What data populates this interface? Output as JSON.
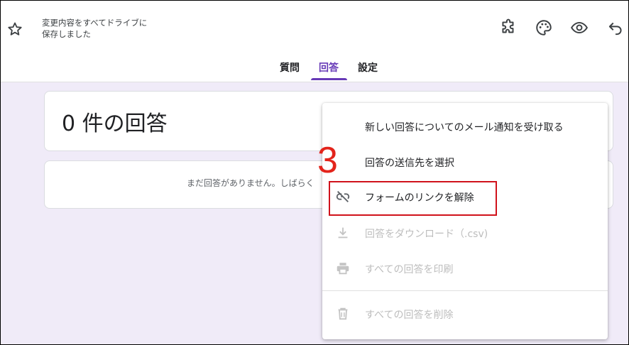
{
  "header": {
    "save_status_line1": "変更内容をすべてドライブに",
    "save_status_line2": "保存しました",
    "tabs": [
      {
        "label": "質問"
      },
      {
        "label": "回答"
      },
      {
        "label": "設定"
      }
    ],
    "active_tab": "回答",
    "icons": [
      "star-outline-icon",
      "puzzle-addon-icon",
      "palette-icon",
      "eye-preview-icon",
      "undo-icon"
    ]
  },
  "responses": {
    "count_label": "0 件の回答",
    "empty_message": "まだ回答がありません。しばらく"
  },
  "menu": {
    "items": [
      {
        "label": "新しい回答についてのメール通知を受け取る",
        "enabled": true
      },
      {
        "label": "回答の送信先を選択",
        "enabled": true
      },
      {
        "label": "フォームのリンクを解除",
        "enabled": true,
        "icon": "unlink-icon"
      },
      {
        "label": "回答をダウンロード（.csv)",
        "enabled": false,
        "icon": "download-icon"
      },
      {
        "label": "すべての回答を印刷",
        "enabled": false,
        "icon": "print-icon"
      },
      {
        "label": "すべての回答を削除",
        "enabled": false,
        "icon": "trash-icon"
      }
    ]
  },
  "annotation": {
    "step_number": "3"
  },
  "colors": {
    "accent": "#673ab7",
    "background": "#f0ebf8",
    "annotation": "#d0121b"
  }
}
